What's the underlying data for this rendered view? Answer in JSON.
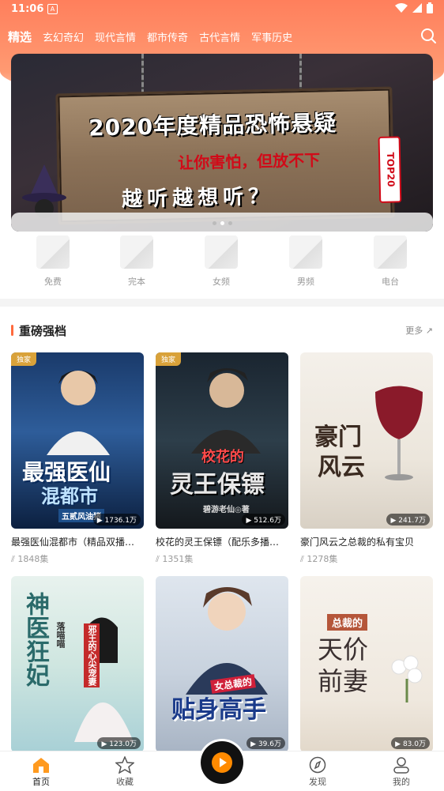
{
  "status": {
    "time": "11:06",
    "notif": "A"
  },
  "tabs": [
    {
      "label": "精选",
      "active": true
    },
    {
      "label": "玄幻奇幻"
    },
    {
      "label": "现代言情"
    },
    {
      "label": "都市传奇"
    },
    {
      "label": "古代言情"
    },
    {
      "label": "军事历史"
    }
  ],
  "banner": {
    "title": "2020年度精品恐怖悬疑",
    "subtitle": "让你害怕，但放不下",
    "tagline": "越听越想听？",
    "badge": "TOP20"
  },
  "categories": [
    "免费",
    "完本",
    "女频",
    "男频",
    "电台"
  ],
  "section": {
    "title": "重磅强档",
    "more": "更多"
  },
  "books": [
    {
      "title": "最强医仙混都市（精品双播…",
      "episodes": "1848集",
      "plays": "1736.1万",
      "badge": "独家",
      "cover_title": "最强医仙",
      "cover_title2": "混都市",
      "cover_author": "五贰风油猪"
    },
    {
      "title": "校花的灵王保镖（配乐多播…",
      "episodes": "1351集",
      "plays": "512.6万",
      "badge": "独家",
      "cover_title": "校花的",
      "cover_title2": "灵王保镖",
      "cover_author": "碧游老仙◎著"
    },
    {
      "title": "豪门风云之总裁的私有宝贝",
      "episodes": "1278集",
      "plays": "241.7万",
      "badge": "",
      "cover_title": "豪门",
      "cover_title2": "风云",
      "cover_author": ""
    },
    {
      "title": "",
      "episodes": "",
      "plays": "123.0万",
      "badge": "",
      "cover_title": "神医狂妃",
      "cover_title2": "邪王的心尖宠妻",
      "cover_author": "落喵喵"
    },
    {
      "title": "",
      "episodes": "",
      "plays": "39.6万",
      "badge": "",
      "cover_title": "贴身高手",
      "cover_title2": "女总裁的",
      "cover_author": ""
    },
    {
      "title": "",
      "episodes": "",
      "plays": "83.0万",
      "badge": "",
      "cover_title": "天价",
      "cover_title2": "前妻",
      "cover_author": "总裁的"
    }
  ],
  "bottom_nav": [
    "首页",
    "收藏",
    "发现",
    "我的"
  ],
  "colors": {
    "accent": "#ff7f5c",
    "badge": "#d9a23a",
    "player": "#ff8a00"
  }
}
